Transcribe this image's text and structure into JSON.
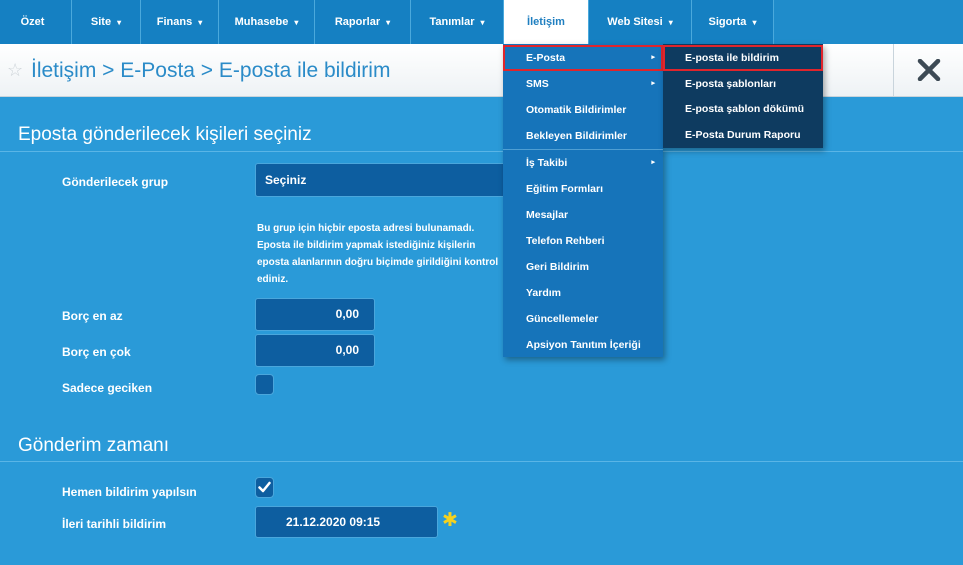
{
  "nav": {
    "items": [
      {
        "label": "Özet",
        "caret": ""
      },
      {
        "label": "Site",
        "caret": "▾"
      },
      {
        "label": "Finans",
        "caret": "▾"
      },
      {
        "label": "Muhasebe",
        "caret": "▾"
      },
      {
        "label": "Raporlar",
        "caret": "▾"
      },
      {
        "label": "Tanımlar",
        "caret": "▾"
      },
      {
        "label": "İletişim",
        "caret": ""
      },
      {
        "label": "Web Sitesi",
        "caret": "▾"
      },
      {
        "label": "Sigorta",
        "caret": "▾"
      }
    ],
    "active_item": "İletişim"
  },
  "breadcrumb": {
    "star_icon": "☆",
    "text": "İletişim > E-Posta > E-posta ile bildirim"
  },
  "form": {
    "section1_title": "Eposta gönderilecek kişileri seçiniz",
    "group_label": "Gönderilecek grup",
    "group_value": "Seçiniz",
    "notice_lines": [
      "Bu grup için hiçbir eposta adresi bulunamadı.",
      "Eposta ile bildirim yapmak istediğiniz kişilerin",
      "eposta alanlarının doğru biçimde girildiğini kontrol",
      "ediniz."
    ],
    "debt_min_label": "Borç en az",
    "debt_min_value": "0,00",
    "debt_max_label": "Borç en çok",
    "debt_max_value": "0,00",
    "only_late_label": "Sadece geciken",
    "only_late_checked": false,
    "section2_title": "Gönderim zamanı",
    "immediate_label": "Hemen bildirim yapılsın",
    "immediate_checked": true,
    "scheduled_label": "İleri tarihli bildirim",
    "scheduled_value": "21.12.2020 09:15",
    "required_star": "✱"
  },
  "dropdown": {
    "items": [
      {
        "label": "E-Posta",
        "arrow": "▸"
      },
      {
        "label": "SMS",
        "arrow": "▸"
      },
      {
        "label": "Otomatik Bildirimler",
        "arrow": ""
      },
      {
        "label": "Bekleyen Bildirimler",
        "arrow": ""
      },
      {
        "label": "İş Takibi",
        "arrow": "▸"
      },
      {
        "label": "Eğitim Formları",
        "arrow": ""
      },
      {
        "label": "Mesajlar",
        "arrow": ""
      },
      {
        "label": "Telefon Rehberi",
        "arrow": ""
      },
      {
        "label": "Geri Bildirim",
        "arrow": ""
      },
      {
        "label": "Yardım",
        "arrow": ""
      },
      {
        "label": "Güncellemeler",
        "arrow": ""
      },
      {
        "label": "Apsiyon Tanıtım İçeriği",
        "arrow": ""
      }
    ],
    "submenu": [
      "E-posta ile bildirim",
      "E-posta şablonları",
      "E-posta şablon dökümü",
      "E-Posta Durum Raporu"
    ]
  },
  "colors": {
    "background": "#2a9ad8",
    "nav_bg": "#1580c2",
    "field_bg": "#0d5ea0",
    "submenu_bg": "#0e3b60",
    "highlight": "#e0252c",
    "required": "#f5d21e"
  }
}
